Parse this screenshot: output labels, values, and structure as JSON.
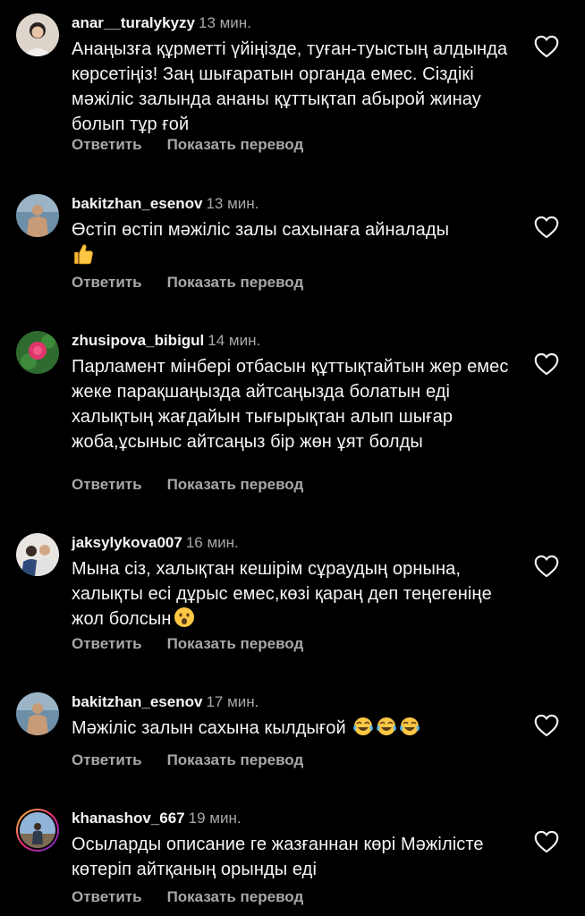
{
  "actions": {
    "reply": "Ответить",
    "translate": "Показать перевод"
  },
  "comments": [
    {
      "username": "anar__turalykyzy",
      "time": "13 мин.",
      "text": "Анаңызға құрметті үйіңізде, туған-туыстың алдында көрсетіңіз! Заң шығаратын органда емес. Сіздікі мәжіліс залында ананы құттықтап абырой жинау болып тұр ғой",
      "emoji": ""
    },
    {
      "username": "bakitzhan_esenov",
      "time": "13 мин.",
      "text": "Өстіп өстіп мәжіліс залы сахынаға айналады",
      "emoji": "thumbs-up"
    },
    {
      "username": "zhusipova_bibigul",
      "time": "14 мин.",
      "text": "Парламент мінбері отбасын құттықтайтын жер емес жеке парақшаңызда айтсаңызда болатын еді халықтың жағдайын тығырықтан алып шығар жоба,ұсыныс айтсаңыз бір жөн ұят болды",
      "emoji": ""
    },
    {
      "username": "jaksylykova007",
      "time": "16 мин.",
      "text": "Мына сіз, халықтан кешірім сұраудың орнына, халықты есі дұрыс емес,көзі қараң деп теңегеніңе жол болсын",
      "emoji": "astonished-face"
    },
    {
      "username": "bakitzhan_esenov",
      "time": "17 мин.",
      "text": "Мәжіліс залын сахына кылдығой",
      "emoji": "tears-of-joy x3"
    },
    {
      "username": "khanashov_667",
      "time": "19 мин.",
      "text": "Осыларды описание ге жазғаннан көрі Мәжілісте көтеріп айтқаның орынды еді",
      "emoji": ""
    }
  ],
  "colors": {
    "background": "#000000",
    "primary_text": "#f5f5f5",
    "secondary_text": "#a8a8a8"
  }
}
